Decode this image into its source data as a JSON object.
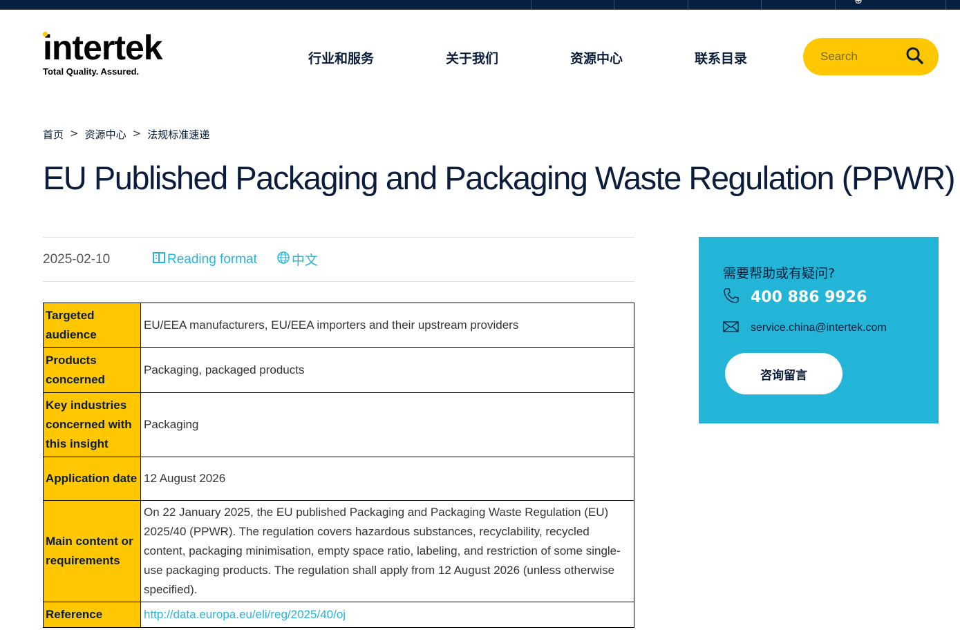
{
  "header": {
    "logo_text": "intertek",
    "tagline": "Total Quality. Assured.",
    "nav": [
      "行业和服务",
      "关于我们",
      "资源中心",
      "联系目录"
    ],
    "search_placeholder": "Search"
  },
  "breadcrumb": [
    "首页",
    "资源中心",
    "法规标准速递"
  ],
  "article": {
    "title": "EU Published Packaging and Packaging Waste Regulation (PPWR)",
    "date": "2025-02-10",
    "reading_format": "Reading format",
    "language": "中文"
  },
  "table": [
    {
      "label": "Targeted audience",
      "value": "EU/EEA manufacturers, EU/EEA importers and their upstream providers"
    },
    {
      "label": "Products concerned",
      "value": "Packaging, packaged products"
    },
    {
      "label": "Key industries concerned with this insight",
      "value": "Packaging"
    },
    {
      "label": "Application date",
      "value": "12 August 2026"
    },
    {
      "label": "Main content or requirements",
      "value": "On 22 January 2025, the EU published Packaging and Packaging Waste Regulation (EU) 2025/40 (PPWR). The regulation covers hazardous substances, recyclability, recycled content, packaging minimisation, empty space ratio, labeling, and restriction of some single-use packaging products. The regulation shall apply from 12 August 2026 (unless otherwise specified)."
    },
    {
      "label": "Reference",
      "value": "http://data.europa.eu/eli/reg/2025/40/oj"
    }
  ],
  "contact": {
    "question": "需要帮助或有疑问?",
    "phone": "400 886 9926",
    "email": "service.china@intertek.com",
    "button": "咨询留言"
  }
}
